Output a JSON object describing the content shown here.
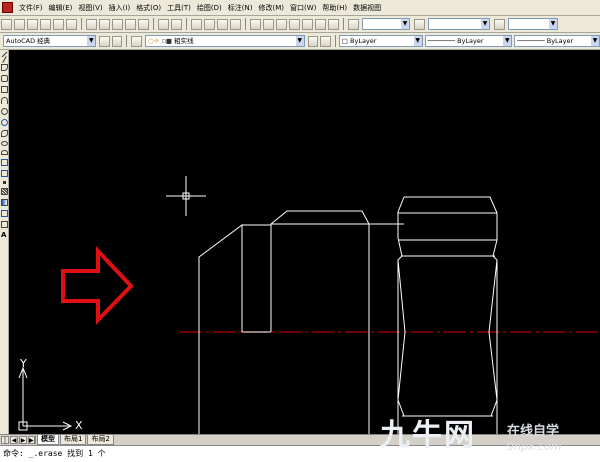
{
  "menu": {
    "items": [
      "文件(F)",
      "编辑(E)",
      "视图(V)",
      "插入(I)",
      "格式(O)",
      "工具(T)",
      "绘图(D)",
      "标注(N)",
      "修改(M)",
      "窗口(W)",
      "帮助(H)",
      "数据视图"
    ]
  },
  "toolbar": {
    "workspace": "AutoCAD 经典",
    "layer": "粗实线",
    "color": "ByLayer",
    "linetype": "ByLayer",
    "lineweight": "ByLayer"
  },
  "ucs": {
    "y_label": "Y",
    "x_label": "X"
  },
  "tabs": [
    {
      "label": "模型",
      "active": true
    },
    {
      "label": "布局1",
      "active": false
    },
    {
      "label": "布局2",
      "active": false
    }
  ],
  "command": {
    "text": "命令: _.erase 找到 1 个"
  },
  "watermark": {
    "brand": "九牛网",
    "slogan": "在线自学",
    "url": "9npx.com"
  },
  "colors": {
    "canvas": "#000000",
    "drawing_lines": "#ffffff",
    "centerline": "#b40000",
    "arrow": "#e01010"
  }
}
